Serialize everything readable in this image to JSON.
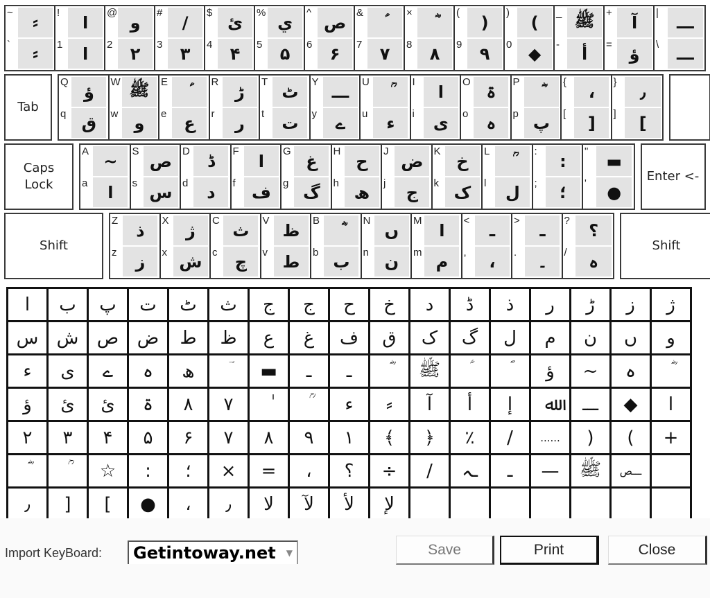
{
  "keyboard": {
    "rows": [
      {
        "left_special": null,
        "keys": [
          {
            "shift": "~",
            "shift_ur": "⸗",
            "base": "`",
            "base_ur": "⸗"
          },
          {
            "shift": "!",
            "shift_ur": "ا",
            "base": "1",
            "base_ur": "ا"
          },
          {
            "shift": "@",
            "shift_ur": "و",
            "base": "2",
            "base_ur": "۲"
          },
          {
            "shift": "#",
            "shift_ur": "/",
            "base": "3",
            "base_ur": "۳"
          },
          {
            "shift": "$",
            "shift_ur": "ئ",
            "base": "4",
            "base_ur": "۴"
          },
          {
            "shift": "%",
            "shift_ur": "ي",
            "base": "5",
            "base_ur": "۵"
          },
          {
            "shift": "^",
            "shift_ur": "ص",
            "base": "6",
            "base_ur": "۶"
          },
          {
            "shift": "&",
            "shift_ur": "ؑ",
            "base": "7",
            "base_ur": "۷"
          },
          {
            "shift": "×",
            "shift_ur": "ؓ",
            "base": "8",
            "base_ur": "۸"
          },
          {
            "shift": "(",
            "shift_ur": "(",
            "base": "9",
            "base_ur": "۹"
          },
          {
            "shift": ")",
            "shift_ur": ")",
            "base": "0",
            "base_ur": "◆"
          },
          {
            "shift": "_",
            "shift_ur": "ﷺ",
            "base": "-",
            "base_ur": "أ"
          },
          {
            "shift": "+",
            "shift_ur": "آ",
            "base": "=",
            "base_ur": "ؤ"
          },
          {
            "shift": "|",
            "shift_ur": "ـــ",
            "base": "\\",
            "base_ur": "ـــ"
          }
        ],
        "right_special": null
      },
      {
        "left_special": "Tab",
        "keys": [
          {
            "shift": "Q",
            "shift_ur": "ؤ",
            "base": "q",
            "base_ur": "ق"
          },
          {
            "shift": "W",
            "shift_ur": "ﷺ",
            "base": "w",
            "base_ur": "و"
          },
          {
            "shift": "E",
            "shift_ur": "ؑ",
            "base": "e",
            "base_ur": "ع"
          },
          {
            "shift": "R",
            "shift_ur": "ڑ",
            "base": "r",
            "base_ur": "ر"
          },
          {
            "shift": "T",
            "shift_ur": "ٹ",
            "base": "t",
            "base_ur": "ت"
          },
          {
            "shift": "Y",
            "shift_ur": "ـــ",
            "base": "y",
            "base_ur": "ے"
          },
          {
            "shift": "U",
            "shift_ur": "ؒ",
            "base": "u",
            "base_ur": "ء"
          },
          {
            "shift": "I",
            "shift_ur": "ا",
            "base": "i",
            "base_ur": "ی"
          },
          {
            "shift": "O",
            "shift_ur": "ۃ",
            "base": "o",
            "base_ur": "ہ"
          },
          {
            "shift": "P",
            "shift_ur": "ؓ",
            "base": "p",
            "base_ur": "پ"
          },
          {
            "shift": "{",
            "shift_ur": "،",
            "base": "[",
            "base_ur": "["
          },
          {
            "shift": "}",
            "shift_ur": "٫",
            "base": "]",
            "base_ur": "]"
          }
        ],
        "right_special": ""
      },
      {
        "left_special": "Caps Lock",
        "keys": [
          {
            "shift": "A",
            "shift_ur": "~",
            "base": "a",
            "base_ur": "ا"
          },
          {
            "shift": "S",
            "shift_ur": "ص",
            "base": "s",
            "base_ur": "س"
          },
          {
            "shift": "D",
            "shift_ur": "ڈ",
            "base": "d",
            "base_ur": "د"
          },
          {
            "shift": "F",
            "shift_ur": "ا",
            "base": "f",
            "base_ur": "ف"
          },
          {
            "shift": "G",
            "shift_ur": "غ",
            "base": "g",
            "base_ur": "گ"
          },
          {
            "shift": "H",
            "shift_ur": "ح",
            "base": "h",
            "base_ur": "ھ"
          },
          {
            "shift": "J",
            "shift_ur": "ض",
            "base": "j",
            "base_ur": "ج"
          },
          {
            "shift": "K",
            "shift_ur": "خ",
            "base": "k",
            "base_ur": "ک"
          },
          {
            "shift": "L",
            "shift_ur": "ؒ",
            "base": "l",
            "base_ur": "ل"
          },
          {
            "shift": ":",
            "shift_ur": ":",
            "base": ";",
            "base_ur": "؛"
          },
          {
            "shift": "\"",
            "shift_ur": "▬",
            "base": "'",
            "base_ur": "●"
          }
        ],
        "right_special": "Enter <-"
      },
      {
        "left_special": "Shift",
        "keys": [
          {
            "shift": "Z",
            "shift_ur": "ذ",
            "base": "z",
            "base_ur": "ز"
          },
          {
            "shift": "X",
            "shift_ur": "ژ",
            "base": "x",
            "base_ur": "ش"
          },
          {
            "shift": "C",
            "shift_ur": "ث",
            "base": "c",
            "base_ur": "چ"
          },
          {
            "shift": "V",
            "shift_ur": "ظ",
            "base": "v",
            "base_ur": "ط"
          },
          {
            "shift": "B",
            "shift_ur": "ؓ",
            "base": "b",
            "base_ur": "ب"
          },
          {
            "shift": "N",
            "shift_ur": "ں",
            "base": "n",
            "base_ur": "ن"
          },
          {
            "shift": "M",
            "shift_ur": "ا",
            "base": "m",
            "base_ur": "م"
          },
          {
            "shift": "<",
            "shift_ur": "ـ",
            "base": ",",
            "base_ur": "،"
          },
          {
            "shift": ">",
            "shift_ur": "ـ",
            "base": ".",
            "base_ur": "۔"
          },
          {
            "shift": "?",
            "shift_ur": "؟",
            "base": "/",
            "base_ur": "ہ"
          }
        ],
        "right_special": "Shift"
      }
    ]
  },
  "character_grid": [
    [
      "ا",
      "ب",
      "پ",
      "ت",
      "ٹ",
      "ث",
      "ج",
      "ج",
      "ح",
      "خ",
      "د",
      "ڈ",
      "ذ",
      "ر",
      "ڑ",
      "ز",
      "ژ"
    ],
    [
      "س",
      "ش",
      "ص",
      "ض",
      "ط",
      "ظ",
      "ع",
      "غ",
      "ف",
      "ق",
      "ک",
      "گ",
      "ل",
      "م",
      "ن",
      "ں",
      "و"
    ],
    [
      "ء",
      "ی",
      "ے",
      "ہ",
      "ھ",
      "ؔ",
      "▬",
      "ـ",
      "ـ",
      "ؓ",
      "ﷺ",
      "ؑ",
      "ؐ",
      "ؤ",
      "~",
      "ہ",
      "ؓ"
    ],
    [
      "ؤ",
      "ئ",
      "ئ",
      "ۃ",
      "٨",
      "٧",
      "ٰ",
      "ؒ",
      "ء",
      "⸗",
      "آ",
      "أ",
      "إ",
      "ﷲ",
      "ـــ",
      "◆",
      "ا"
    ],
    [
      "۲",
      "۳",
      "۴",
      "۵",
      "۶",
      "۷",
      "۸",
      "۹",
      "۱",
      "﴾",
      "﴿",
      "٪",
      "/",
      "......",
      "(",
      ")",
      "+"
    ],
    [
      "ؓ",
      "ؒ",
      "☆",
      ":",
      "؛",
      "×",
      "=",
      "،",
      "؟",
      "÷",
      "/",
      "ـہ",
      "ـ",
      "—",
      "ﷺ",
      "ـــص",
      ""
    ],
    [
      "٫",
      "[",
      "]",
      "●",
      "،",
      "٫",
      "لا",
      "لآ",
      "لأ",
      "لإ",
      "",
      "",
      "",
      "",
      "",
      "",
      ""
    ]
  ],
  "footer": {
    "import_label": "Import KeyBoard:",
    "import_value": "Getintoway.net",
    "save_label": "Save",
    "print_label": "Print",
    "close_label": "Close"
  }
}
